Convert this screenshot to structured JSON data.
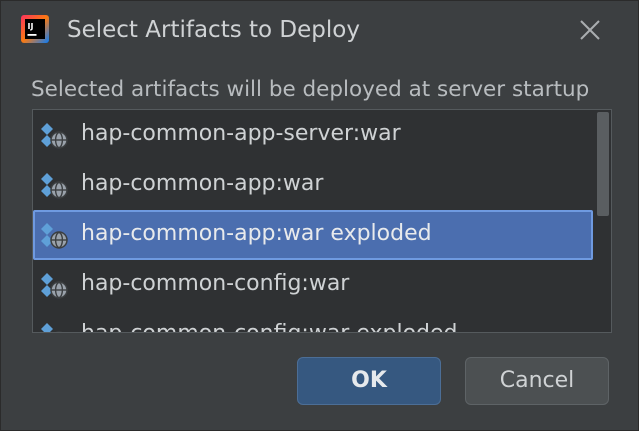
{
  "window": {
    "title": "Select Artifacts to Deploy",
    "app_icon": "intellij-idea-icon",
    "close_icon": "close-icon"
  },
  "description": "Selected artifacts will be deployed at server startup",
  "artifacts": [
    {
      "label": "hap-common-app-server:war",
      "icon": "web-artifact-icon",
      "selected": false
    },
    {
      "label": "hap-common-app:war",
      "icon": "web-artifact-icon",
      "selected": false
    },
    {
      "label": "hap-common-app:war exploded",
      "icon": "web-artifact-icon",
      "selected": true
    },
    {
      "label": "hap-common-config:war",
      "icon": "web-artifact-icon",
      "selected": false
    },
    {
      "label": "hap-common-config:war exploded",
      "icon": "web-artifact-icon",
      "selected": false
    }
  ],
  "buttons": {
    "ok": "OK",
    "cancel": "Cancel"
  },
  "colors": {
    "background": "#3c3f41",
    "selection": "#4b6eaf",
    "primary_button": "#365880"
  }
}
